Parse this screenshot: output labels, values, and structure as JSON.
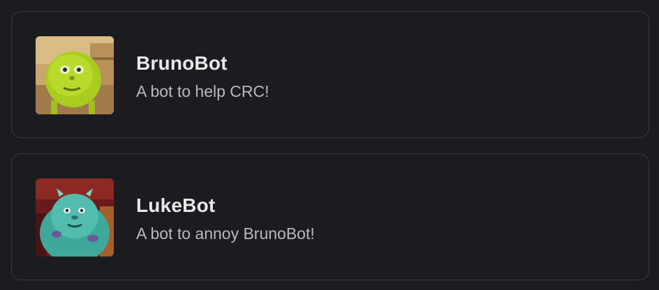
{
  "bots": [
    {
      "name": "BrunoBot",
      "description": "A bot to help CRC!",
      "avatar_icon": "green-one-eyed-monster-avatar",
      "avatar_color": "#b8d82a"
    },
    {
      "name": "LukeBot",
      "description": "A bot to annoy BrunoBot!",
      "avatar_icon": "teal-furry-monster-avatar",
      "avatar_color": "#4fb7a8"
    }
  ]
}
